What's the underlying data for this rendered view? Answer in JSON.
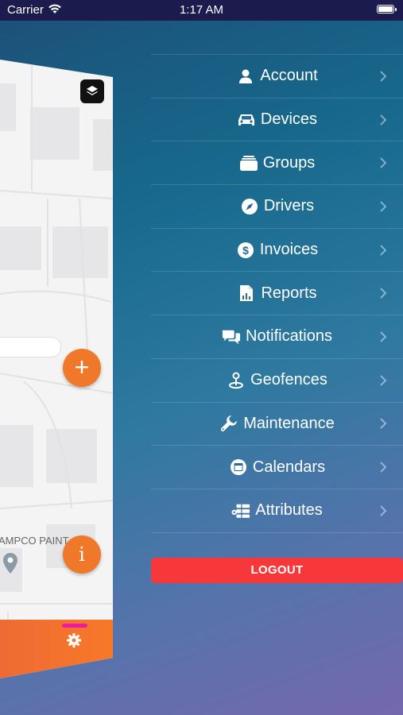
{
  "status_bar": {
    "carrier": "Carrier",
    "time": "1:17 AM"
  },
  "map_panel": {
    "poi_label": "AMPCO PAINT",
    "add_symbol": "+",
    "info_symbol": "i",
    "icons": [
      "layers-icon",
      "location-pin-icon",
      "gear-icon"
    ]
  },
  "menu": {
    "items": [
      {
        "label": "Account",
        "icon": "person-icon"
      },
      {
        "label": "Devices",
        "icon": "car-icon"
      },
      {
        "label": "Groups",
        "icon": "folder-stack-icon"
      },
      {
        "label": "Drivers",
        "icon": "compass-icon"
      },
      {
        "label": "Invoices",
        "icon": "dollar-icon"
      },
      {
        "label": "Reports",
        "icon": "report-icon"
      },
      {
        "label": "Notifications",
        "icon": "chat-bubbles-icon"
      },
      {
        "label": "Geofences",
        "icon": "geofence-pin-icon"
      },
      {
        "label": "Maintenance",
        "icon": "wrench-icon"
      },
      {
        "label": "Calendars",
        "icon": "calendar-icon"
      },
      {
        "label": "Attributes",
        "icon": "attributes-icon"
      }
    ],
    "logout_label": "LOGOUT"
  },
  "colors": {
    "status_bar_bg": "#1b1b4e",
    "accent_orange": "#f0782a",
    "logout_red": "#f6383b",
    "indicator_pink": "#ee1aa5"
  }
}
